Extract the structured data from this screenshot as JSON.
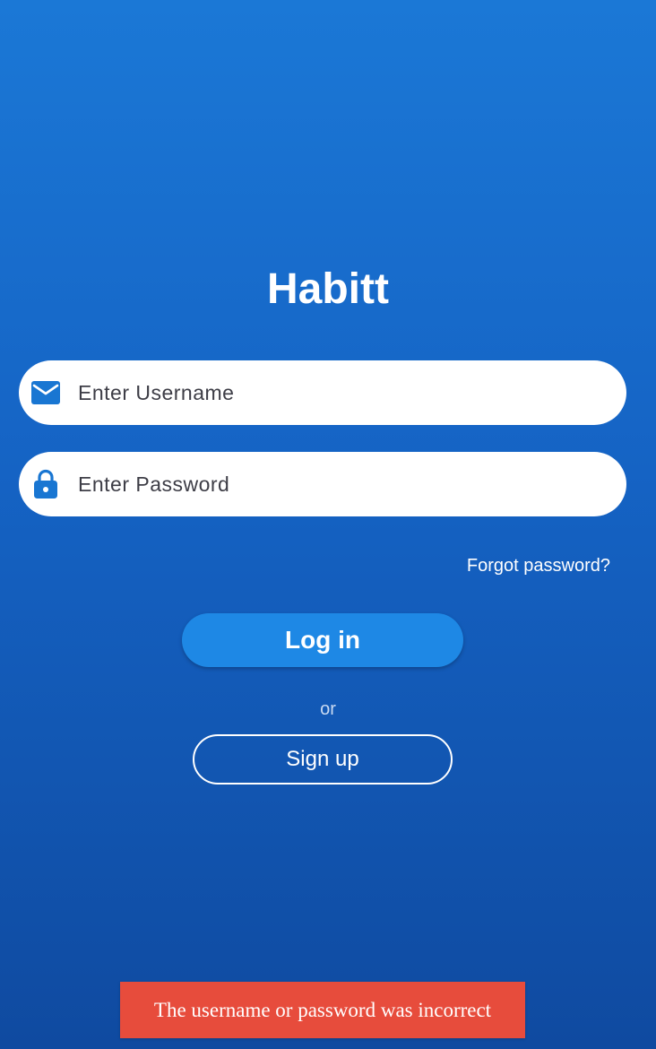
{
  "app": {
    "title": "Habitt"
  },
  "form": {
    "username": {
      "placeholder": "Enter Username",
      "value": "",
      "icon": "mail-icon"
    },
    "password": {
      "placeholder": "Enter Password",
      "value": "",
      "icon": "lock-icon"
    },
    "forgot_label": "Forgot password?",
    "login_label": "Log in",
    "or_label": "or",
    "signup_label": "Sign up"
  },
  "toast": {
    "message": "The username or password was incorrect"
  },
  "colors": {
    "background_top": "#1b78d6",
    "background_bottom": "#0f4aa0",
    "primary_button": "#1e88e5",
    "icon": "#1976d2",
    "error_toast": "#e74c3c"
  }
}
